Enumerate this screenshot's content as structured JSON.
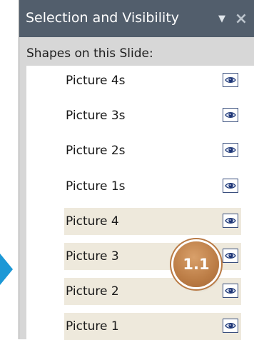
{
  "pane": {
    "title": "Selection and Visibility",
    "dropdown_icon": "triangle-down-icon",
    "close_icon": "close-icon"
  },
  "section": {
    "label": "Shapes on this Slide:"
  },
  "shapes": [
    {
      "label": "Picture 4s",
      "highlighted": false,
      "visible": true
    },
    {
      "label": "Picture 3s",
      "highlighted": false,
      "visible": true
    },
    {
      "label": "Picture 2s",
      "highlighted": false,
      "visible": true
    },
    {
      "label": "Picture 1s",
      "highlighted": false,
      "visible": true
    },
    {
      "label": "Picture 4",
      "highlighted": true,
      "visible": true
    },
    {
      "label": "Picture 3",
      "highlighted": true,
      "visible": true
    },
    {
      "label": "Picture 2",
      "highlighted": true,
      "visible": true
    },
    {
      "label": "Picture 1",
      "highlighted": true,
      "visible": true
    }
  ],
  "callout": {
    "label": "1.1",
    "color": "#bb7c45"
  },
  "colors": {
    "title_bar": "#525e6c",
    "highlight_row": "#eee9dc",
    "pointer_arrow": "#1c98d6"
  }
}
